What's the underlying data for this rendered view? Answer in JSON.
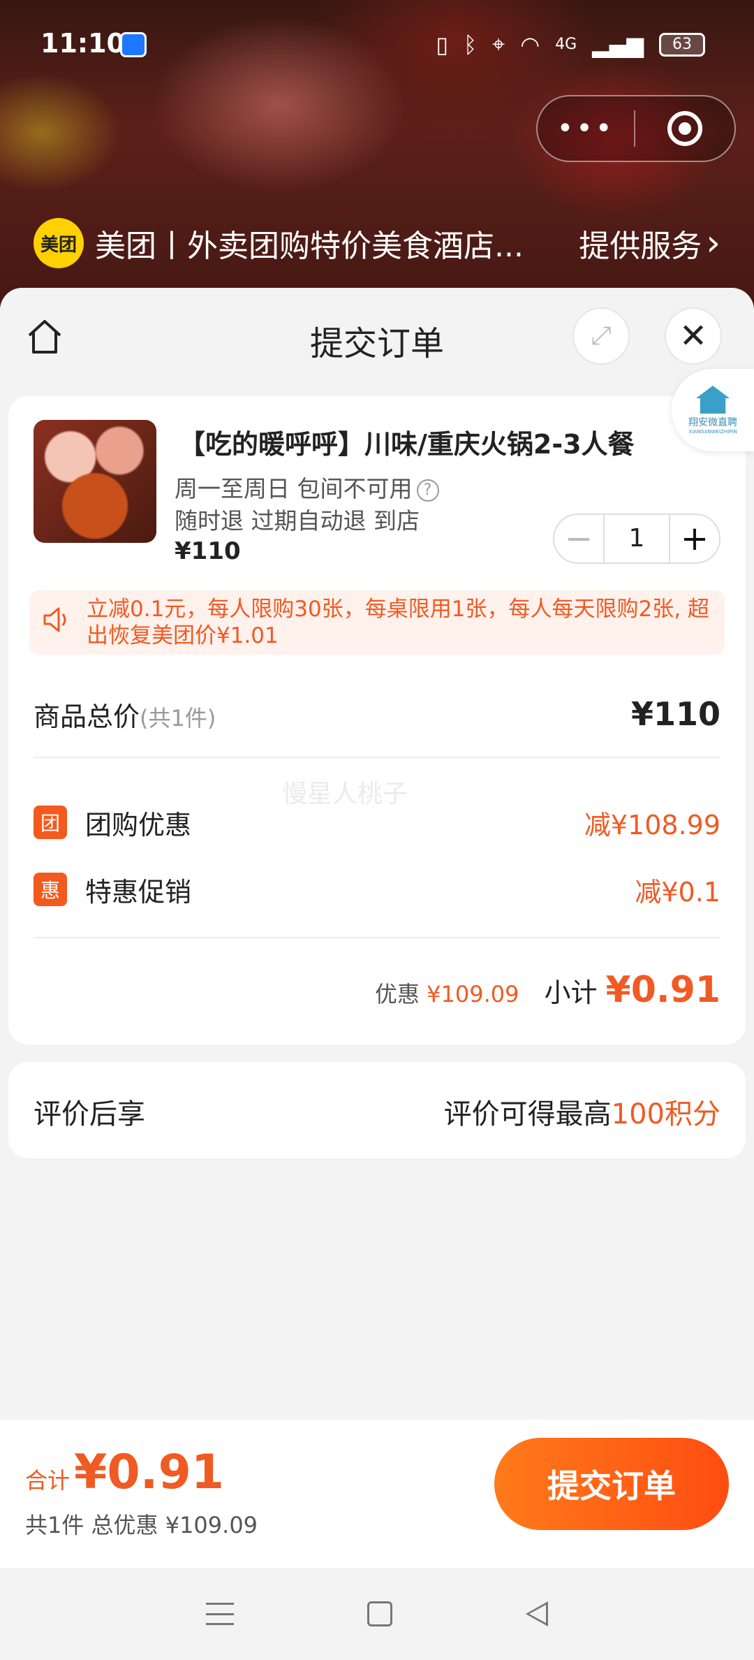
{
  "status_bar": {
    "time": "11:10",
    "network": "4G",
    "battery": "63"
  },
  "capsule": {
    "more_label": "•••"
  },
  "miniprogram": {
    "logo_text": "美团",
    "title": "美团丨外卖团购特价美食酒店...",
    "service_label": "提供服务",
    "service_chevron": "›"
  },
  "sheet": {
    "title": "提交订单",
    "close_glyph": "✕",
    "expand_glyph": "⤢"
  },
  "float_badge": {
    "text": "翔安微直聘",
    "sub": "XIANGANWEIZHIPIN"
  },
  "product": {
    "title": "【吃的暖呼呼】川味/重庆火锅2-3人餐",
    "line1": "周一至周日 包间不可用",
    "help_glyph": "?",
    "line2": "随时退 过期自动退 到店",
    "price": "¥110",
    "quantity": "1",
    "minus": "−",
    "plus": "+"
  },
  "promo_notice": "立减0.1元，每人限购30张，每桌限用1张，每人每天限购2张, 超出恢复美团价¥1.01",
  "summary": {
    "total_label": "商品总价",
    "total_count": "(共1件)",
    "total_value": "¥110",
    "watermark": "慢星人桃子",
    "discounts": [
      {
        "badge": "团",
        "label": "团购优惠",
        "amount": "减¥108.99"
      },
      {
        "badge": "惠",
        "label": "特惠促销",
        "amount": "减¥0.1"
      }
    ],
    "discount_label": "优惠",
    "discount_value": "¥109.09",
    "subtotal_label": "小计",
    "subtotal_value": "¥0.91"
  },
  "review": {
    "label": "评价后享",
    "text_prefix": "评价可得最高",
    "text_highlight": "100积分"
  },
  "bottom": {
    "total_label": "合计",
    "total_value": "¥0.91",
    "sub": "共1件 总优惠 ¥109.09",
    "submit_label": "提交订单"
  },
  "colors": {
    "accent": "#f05a23",
    "brand_yellow": "#ffd100"
  }
}
